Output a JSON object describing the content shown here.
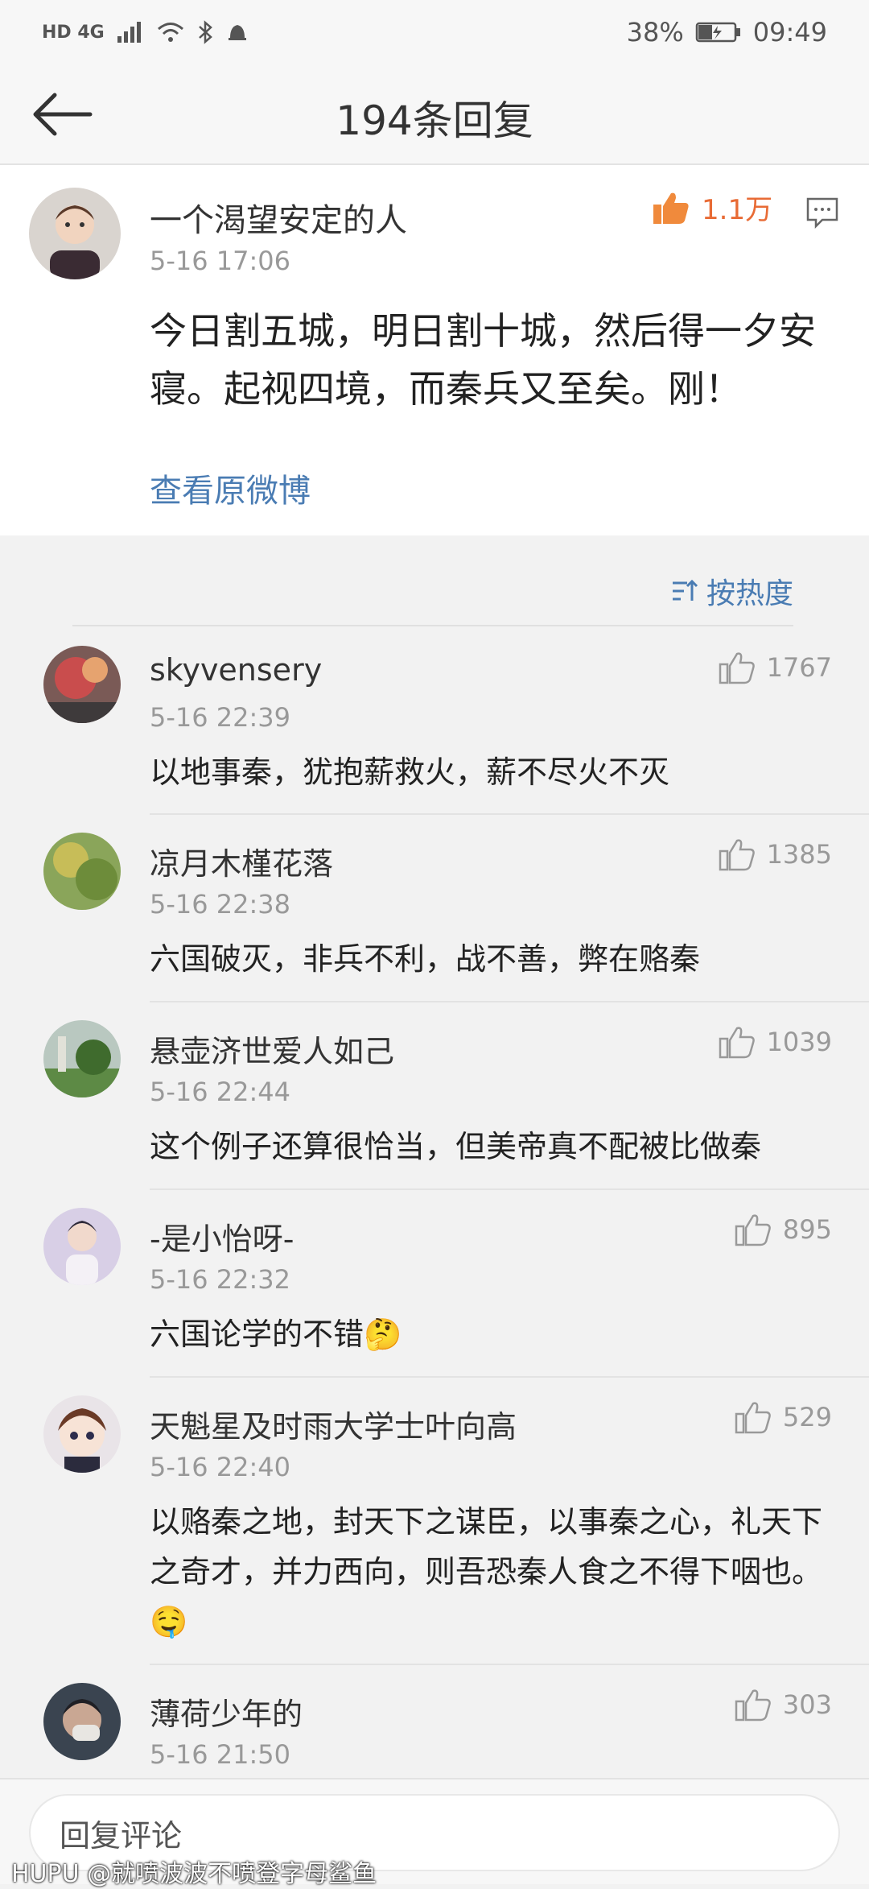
{
  "status_bar": {
    "network": "HD 4G",
    "battery": "38%",
    "time": "09:49"
  },
  "header": {
    "title": "194条回复"
  },
  "original": {
    "author": "一个渴望安定的人",
    "time": "5-16 17:06",
    "likes": "1.1万",
    "content": "今日割五城，明日割十城，然后得一夕安寝。起视四境，而秦兵又至矣。刚！",
    "view_link": "查看原微博"
  },
  "sort": {
    "label": "按热度"
  },
  "replies": [
    {
      "user": "skyvensery",
      "time": "5-16 22:39",
      "likes": "1767",
      "text": "以地事秦，犹抱薪救火，薪不尽火不灭"
    },
    {
      "user": "凉月木槿花落",
      "time": "5-16 22:38",
      "likes": "1385",
      "text": "六国破灭，非兵不利，战不善，弊在赂秦"
    },
    {
      "user": "悬壶济世爱人如己",
      "time": "5-16 22:44",
      "likes": "1039",
      "text": "这个例子还算很恰当，但美帝真不配被比做秦"
    },
    {
      "user": "-是小怡呀-",
      "time": "5-16 22:32",
      "likes": "895",
      "text": "六国论学的不错🤔"
    },
    {
      "user": "天魁星及时雨大学士叶向高",
      "time": "5-16 22:40",
      "likes": "529",
      "text": "以赂秦之地，封天下之谋臣，以事秦之心，礼天下之奇才，并力西向，则吾恐秦人食之不得下咽也。🤤"
    },
    {
      "user": "薄荷少年的",
      "time": "5-16 21:50",
      "likes": "303",
      "text": ""
    }
  ],
  "input": {
    "placeholder": "回复评论"
  },
  "watermark": "HUPU @就喷波波不喷登字母鲨鱼"
}
